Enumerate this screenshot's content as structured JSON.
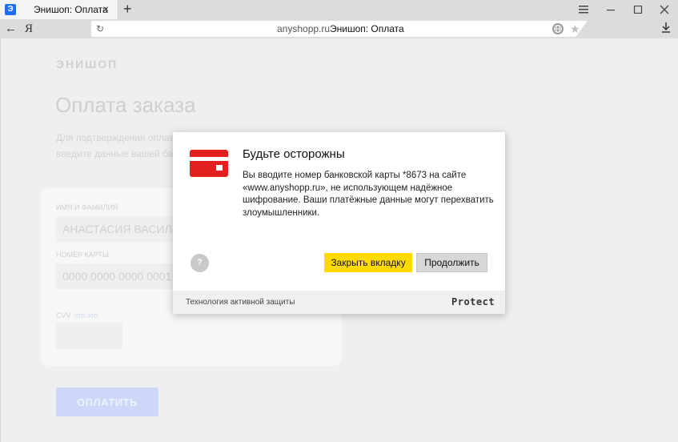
{
  "browser": {
    "tab": {
      "favicon_letter": "Э",
      "title": "Энишоп: Оплата",
      "close_glyph": "×"
    },
    "new_tab_glyph": "+",
    "nav": {
      "back_glyph": "←",
      "logo": "Я"
    },
    "omnibox": {
      "reload_glyph": "↻",
      "domain": "anyshopp.ru",
      "page_title": "Энишоп: Оплата",
      "star_glyph": "★"
    }
  },
  "page": {
    "logo": "ЭНИШОП",
    "title": "Оплата заказа",
    "subtitle_line1": "Для подтверждения оплаты",
    "subtitle_line2": "введите данные вашей банковской карты",
    "form": {
      "name_label": "ИМЯ И ФАМИЛИЯ",
      "name_value": "АНАСТАСИЯ ВАСИЛЬЕВА",
      "card_label": "НОМЕР КАРТЫ",
      "card_value": "0000 0000 0000 0001",
      "cvv_label": "CVV",
      "cvv_hint": "что это",
      "cvv_value": ""
    },
    "pay_button": "ОПЛАТИТЬ"
  },
  "dialog": {
    "title": "Будьте осторожны",
    "message": "Вы вводите номер банковской карты *8673 на сайте «www.anyshopp.ru», не использующем надёжное шифрование. Ваши платёжные данные могут перехватить злоумышленники.",
    "help_label": "?",
    "close_tab_button": "Закрыть вкладку",
    "continue_button": "Продолжить",
    "footer_text": "Технология активной защиты",
    "protect_logo": "Protect",
    "icon": "credit-card-icon",
    "colors": {
      "card_red": "#e3201f",
      "primary_yellow": "#ffdb00"
    }
  }
}
